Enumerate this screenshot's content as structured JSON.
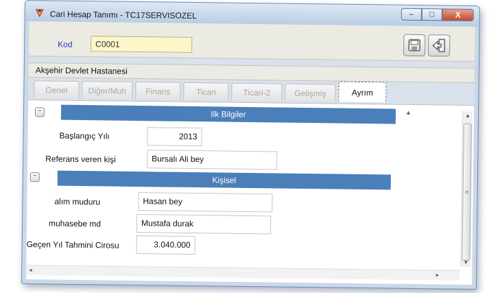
{
  "window": {
    "title": "Cari Hesap Tanımı - TC17SERVISOZEL",
    "controls": {
      "minimize": "–",
      "maximize": "□",
      "close": "X"
    }
  },
  "header": {
    "kod_label": "Kod",
    "kod_value": "C0001"
  },
  "record_name": "Akşehir Devlet Hastanesi",
  "tabs": [
    {
      "label": "Genel"
    },
    {
      "label": "Diğer/Muh"
    },
    {
      "label": "Finans"
    },
    {
      "label": "Ticari"
    },
    {
      "label": "Ticari-2"
    },
    {
      "label": "Gelişmiş"
    },
    {
      "label": "Ayrım",
      "active": true
    }
  ],
  "sections": {
    "ilk_bilgiler": {
      "title": "Ilk Bilgiler",
      "fields": [
        {
          "label": "Başlangıç Yılı",
          "value": "2013"
        },
        {
          "label": "Referans veren kişi",
          "value": "Bursalı Ali bey"
        }
      ]
    },
    "kisisel": {
      "title": "Kişisel",
      "fields": [
        {
          "label": "alım muduru",
          "value": "Hasan bey"
        },
        {
          "label": "muhasebe md",
          "value": "Mustafa durak"
        },
        {
          "label": "Geçen Yıl Tahmini Cirosu",
          "value": "3.040.000"
        }
      ]
    }
  },
  "icons": [
    "app-logo-icon",
    "save-icon",
    "exit-door-icon",
    "collapse-icon"
  ],
  "colors": {
    "section_bar": "#4a7fba",
    "kod_label": "#2035c8",
    "kod_input_bg": "#fdf6c8",
    "close_button": "#c24a30"
  }
}
